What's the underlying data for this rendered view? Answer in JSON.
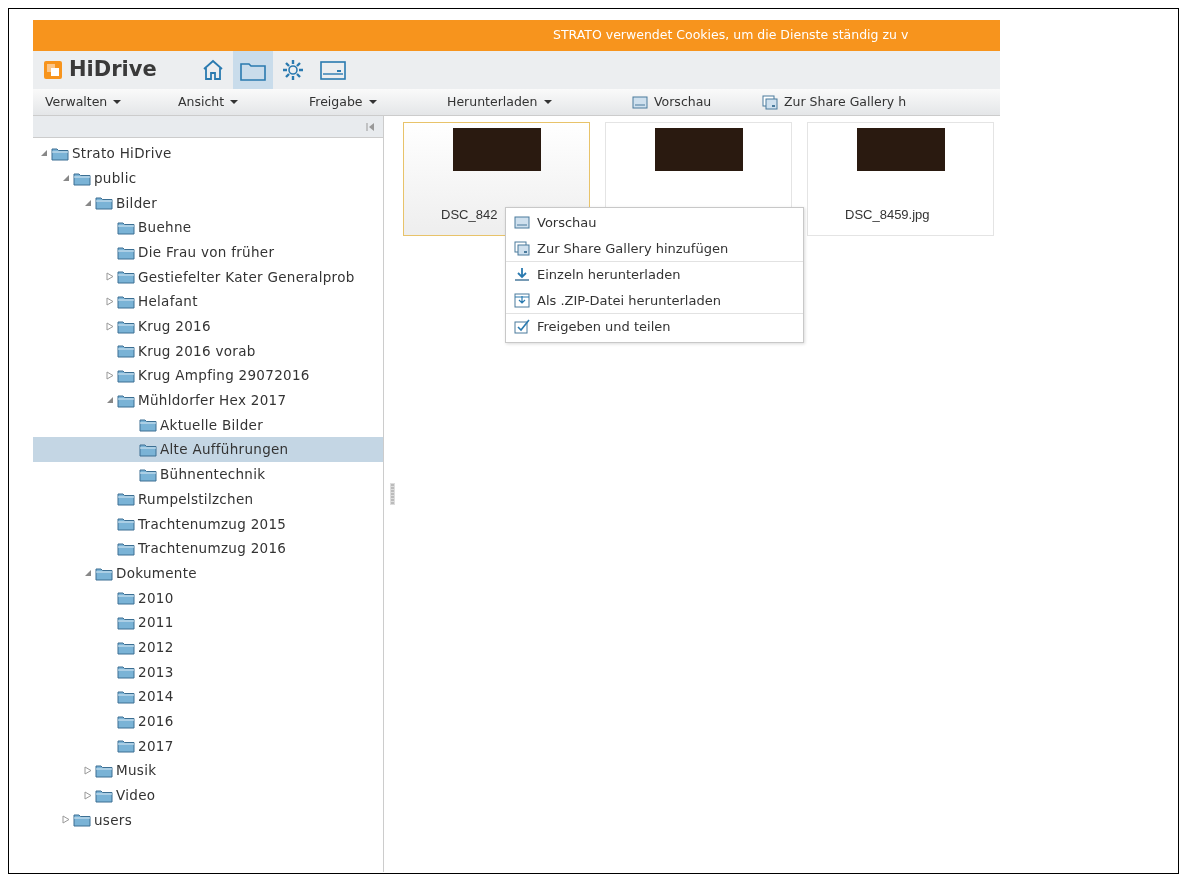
{
  "banner": {
    "text": "STRATO verwendet Cookies, um die Dienste ständig zu v"
  },
  "header": {
    "logo": "HiDrive",
    "nav": [
      {
        "selected": false
      },
      {
        "selected": true
      },
      {
        "selected": false
      },
      {
        "selected": false
      }
    ]
  },
  "toolbar": [
    {
      "kind": "menu",
      "label": "Verwalten"
    },
    {
      "kind": "menu",
      "label": "Ansicht"
    },
    {
      "kind": "menu",
      "label": "Freigabe"
    },
    {
      "kind": "menu",
      "label": "Herunterladen"
    },
    {
      "kind": "action",
      "label": "Vorschau"
    },
    {
      "kind": "action",
      "label": "Zur Share Gallery h"
    }
  ],
  "tree": [
    {
      "label": "Strato HiDrive",
      "kind": "expanded",
      "selected": false,
      "children": [
        {
          "label": "public",
          "kind": "expanded",
          "selected": false,
          "children": [
            {
              "label": "Bilder",
              "kind": "expanded",
              "selected": false,
              "children": [
                {
                  "label": "Buehne",
                  "kind": "leaf",
                  "selected": false
                },
                {
                  "label": "Die Frau von früher",
                  "kind": "leaf",
                  "selected": false
                },
                {
                  "label": "Gestiefelter Kater Generalprob",
                  "kind": "collapsed",
                  "selected": false
                },
                {
                  "label": "Helafant",
                  "kind": "collapsed",
                  "selected": false
                },
                {
                  "label": "Krug 2016",
                  "kind": "collapsed",
                  "selected": false
                },
                {
                  "label": "Krug 2016 vorab",
                  "kind": "leaf",
                  "selected": false
                },
                {
                  "label": "Krug Ampfing 29072016",
                  "kind": "collapsed",
                  "selected": false
                },
                {
                  "label": "Mühldorfer Hex 2017",
                  "kind": "expanded",
                  "selected": false,
                  "children": [
                    {
                      "label": "Aktuelle Bilder",
                      "kind": "leaf",
                      "selected": false
                    },
                    {
                      "label": "Alte Aufführungen",
                      "kind": "leaf",
                      "selected": true
                    },
                    {
                      "label": "Bühnentechnik",
                      "kind": "leaf",
                      "selected": false
                    }
                  ]
                },
                {
                  "label": "Rumpelstilzchen",
                  "kind": "leaf",
                  "selected": false
                },
                {
                  "label": "Trachtenumzug 2015",
                  "kind": "leaf",
                  "selected": false
                },
                {
                  "label": "Trachtenumzug 2016",
                  "kind": "leaf",
                  "selected": false
                }
              ]
            },
            {
              "label": "Dokumente",
              "kind": "expanded",
              "selected": false,
              "children": [
                {
                  "label": "2010",
                  "kind": "leaf",
                  "selected": false
                },
                {
                  "label": "2011",
                  "kind": "leaf",
                  "selected": false
                },
                {
                  "label": "2012",
                  "kind": "leaf",
                  "selected": false
                },
                {
                  "label": "2013",
                  "kind": "leaf",
                  "selected": false
                },
                {
                  "label": "2014",
                  "kind": "leaf",
                  "selected": false
                },
                {
                  "label": "2016",
                  "kind": "leaf",
                  "selected": false
                },
                {
                  "label": "2017",
                  "kind": "leaf",
                  "selected": false
                }
              ]
            },
            {
              "label": "Musik",
              "kind": "collapsed",
              "selected": false
            },
            {
              "label": "Video",
              "kind": "collapsed",
              "selected": false
            }
          ]
        },
        {
          "label": "users",
          "kind": "collapsed",
          "selected": false
        }
      ]
    }
  ],
  "files": [
    {
      "name": "DSC_842",
      "selected": true
    },
    {
      "selected": false
    },
    {
      "name": "DSC_8459.jpg",
      "selected": false
    }
  ],
  "context_menu": [
    [
      {
        "label": "Vorschau"
      },
      {
        "label": "Zur Share Gallery hinzufügen"
      }
    ],
    [
      {
        "label": "Einzeln herunterladen"
      },
      {
        "label": "Als .ZIP-Datei herunterladen"
      }
    ],
    [
      {
        "label": "Freigeben und teilen"
      }
    ]
  ]
}
